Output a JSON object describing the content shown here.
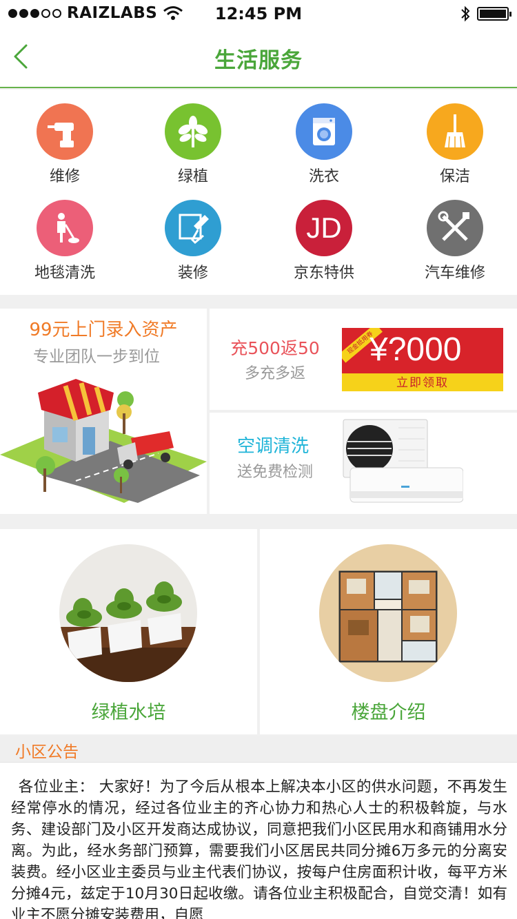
{
  "status_bar": {
    "carrier": "RAIZLABS",
    "time": "12:45 PM"
  },
  "nav": {
    "title": "生活服务"
  },
  "services": [
    {
      "label": "维修",
      "icon": "drill-icon",
      "color": "#f07452"
    },
    {
      "label": "绿植",
      "icon": "plant-icon",
      "color": "#78c230"
    },
    {
      "label": "洗衣",
      "icon": "washing-machine-icon",
      "color": "#4b8be6"
    },
    {
      "label": "保洁",
      "icon": "broom-icon",
      "color": "#f7a81e"
    },
    {
      "label": "地毯清洗",
      "icon": "carpet-cleaner-icon",
      "color": "#ec5f78"
    },
    {
      "label": "装修",
      "icon": "paint-roller-icon",
      "color": "#2f9ed2"
    },
    {
      "label": "京东特供",
      "icon": "jd-logo-icon",
      "glyph": "JD",
      "color": "#c9203a"
    },
    {
      "label": "汽车维修",
      "icon": "tools-icon",
      "color": "#707070"
    }
  ],
  "promo": {
    "asset": {
      "title": "99元上门录入资产",
      "subtitle": "专业团队一步到位"
    },
    "recharge": {
      "title": "充500返50",
      "subtitle": "多充多返",
      "coupon_amount": "¥?000",
      "coupon_button": "立即领取",
      "coupon_tag": "现金抵用券"
    },
    "aircon": {
      "title": "空调清洗",
      "subtitle": "送免费检测"
    }
  },
  "features": [
    {
      "label": "绿植水培"
    },
    {
      "label": "楼盘介绍"
    }
  ],
  "notice": {
    "title": "小区公告",
    "text": "各位业主： 大家好！为了今后从根本上解决本小区的供水问题，不再发生经常停水的情况，经过各位业主的齐心协力和热心人士的积极斡旋，与水务、建设部门及小区开发商达成协议，同意把我们小区民用水和商铺用水分离。为此，经水务部门预算，需要我们小区居民共同分摊6万多元的分离安装费。经小区业主委员与业主代表们协议，按每户住房面积计收，每平方米分摊4元，兹定于10月30日起收缴。请各位业主积极配合，自觉交清！如有业主不愿分摊安装费用，自愿"
  }
}
